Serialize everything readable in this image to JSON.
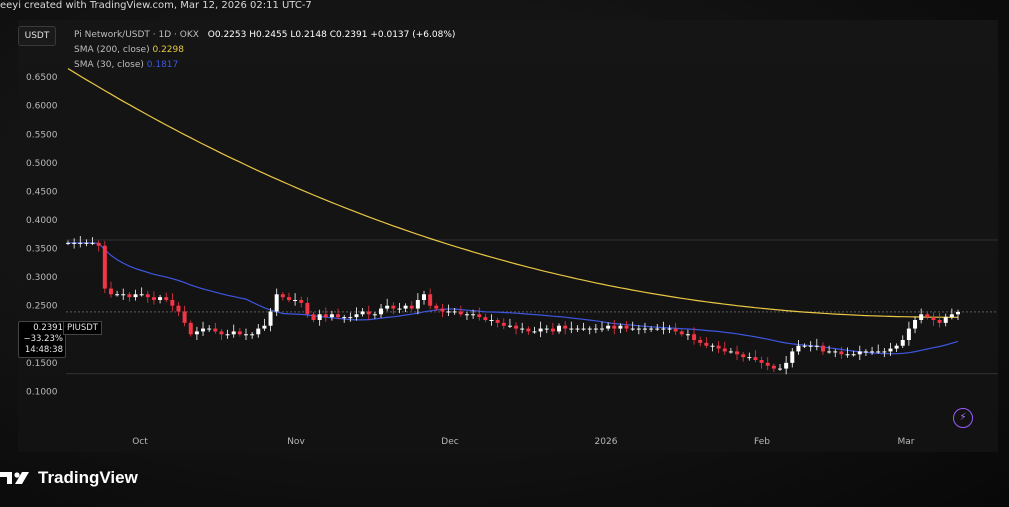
{
  "watermark": "eeyi created with TradingView.com, Mar 12, 2026 02:11 UTC-7",
  "unit_tag": "USDT",
  "legend": {
    "title": "Pi Network/USDT · 1D · OKX",
    "ohlc": "O0.2253  H0.2455  L0.2148  C0.2391  +0.0137 (+6.08%)",
    "sma200_label": "SMA (200, close)",
    "sma200_value": "0.2298",
    "sma30_label": "SMA (30, close)",
    "sma30_value": "0.1817"
  },
  "price_box": {
    "price": "0.2391",
    "change": "−33.23%",
    "countdown": "14:48:38"
  },
  "symbol_tag": "PIUSDT",
  "brand": {
    "name": "TradingView",
    "icon": "tradingview-logo-icon"
  },
  "bolt_icon": "lightning-icon",
  "colors": {
    "up": "#ffffff",
    "down": "#f23645",
    "sma200": "#e9c743",
    "sma30": "#3d56e0"
  },
  "chart_data": {
    "type": "candlestick",
    "y_ticks": [
      "0.6500",
      "0.6000",
      "0.5500",
      "0.5000",
      "0.4500",
      "0.4000",
      "0.3500",
      "0.3000",
      "0.2500",
      "0.2000",
      "0.1500",
      "0.1000"
    ],
    "x_ticks": [
      "Oct",
      "Nov",
      "Dec",
      "2026",
      "Feb",
      "Mar"
    ],
    "ylim": [
      0.085,
      0.68
    ],
    "close_series": [
      0.36,
      0.36,
      0.36,
      0.36,
      0.36,
      0.355,
      0.28,
      0.27,
      0.27,
      0.27,
      0.265,
      0.27,
      0.27,
      0.265,
      0.26,
      0.265,
      0.26,
      0.25,
      0.24,
      0.22,
      0.2,
      0.205,
      0.21,
      0.21,
      0.205,
      0.2,
      0.2,
      0.205,
      0.2,
      0.2,
      0.2,
      0.21,
      0.215,
      0.24,
      0.27,
      0.265,
      0.26,
      0.26,
      0.255,
      0.235,
      0.225,
      0.235,
      0.23,
      0.235,
      0.23,
      0.23,
      0.23,
      0.235,
      0.24,
      0.235,
      0.235,
      0.245,
      0.25,
      0.245,
      0.245,
      0.25,
      0.245,
      0.26,
      0.27,
      0.25,
      0.245,
      0.24,
      0.24,
      0.24,
      0.235,
      0.235,
      0.235,
      0.23,
      0.225,
      0.225,
      0.22,
      0.215,
      0.215,
      0.21,
      0.21,
      0.205,
      0.205,
      0.21,
      0.21,
      0.205,
      0.215,
      0.21,
      0.21,
      0.21,
      0.21,
      0.21,
      0.21,
      0.21,
      0.215,
      0.21,
      0.215,
      0.21,
      0.21,
      0.21,
      0.21,
      0.21,
      0.21,
      0.21,
      0.21,
      0.205,
      0.2,
      0.2,
      0.19,
      0.185,
      0.18,
      0.18,
      0.175,
      0.17,
      0.17,
      0.165,
      0.16,
      0.16,
      0.155,
      0.15,
      0.145,
      0.14,
      0.14,
      0.15,
      0.17,
      0.18,
      0.18,
      0.18,
      0.18,
      0.17,
      0.17,
      0.17,
      0.165,
      0.165,
      0.165,
      0.17,
      0.17,
      0.17,
      0.17,
      0.17,
      0.175,
      0.18,
      0.19,
      0.21,
      0.225,
      0.235,
      0.23,
      0.225,
      0.22,
      0.23,
      0.235,
      0.2391
    ]
  }
}
